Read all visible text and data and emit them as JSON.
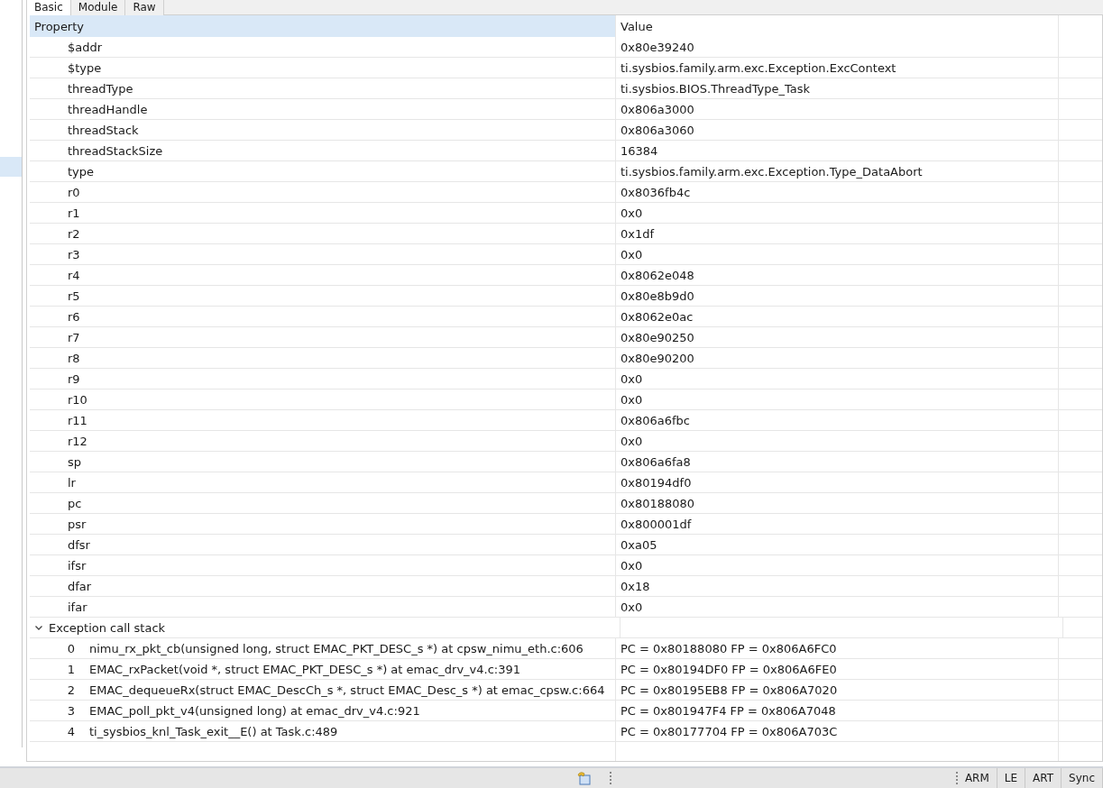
{
  "tabs": [
    {
      "label": "Basic",
      "selected": true
    },
    {
      "label": "Module",
      "selected": false
    },
    {
      "label": "Raw",
      "selected": false
    }
  ],
  "table": {
    "columns": [
      "Property",
      "Value"
    ],
    "rows": [
      {
        "name": "$addr",
        "value": "0x80e39240"
      },
      {
        "name": "$type",
        "value": "ti.sysbios.family.arm.exc.Exception.ExcContext"
      },
      {
        "name": "threadType",
        "value": "ti.sysbios.BIOS.ThreadType_Task"
      },
      {
        "name": "threadHandle",
        "value": "0x806a3000"
      },
      {
        "name": "threadStack",
        "value": "0x806a3060"
      },
      {
        "name": "threadStackSize",
        "value": "16384"
      },
      {
        "name": "type",
        "value": "ti.sysbios.family.arm.exc.Exception.Type_DataAbort"
      },
      {
        "name": "r0",
        "value": "0x8036fb4c"
      },
      {
        "name": "r1",
        "value": "0x0"
      },
      {
        "name": "r2",
        "value": "0x1df"
      },
      {
        "name": "r3",
        "value": "0x0"
      },
      {
        "name": "r4",
        "value": "0x8062e048"
      },
      {
        "name": "r5",
        "value": "0x80e8b9d0"
      },
      {
        "name": "r6",
        "value": "0x8062e0ac"
      },
      {
        "name": "r7",
        "value": "0x80e90250"
      },
      {
        "name": "r8",
        "value": "0x80e90200"
      },
      {
        "name": "r9",
        "value": "0x0"
      },
      {
        "name": "r10",
        "value": "0x0"
      },
      {
        "name": "r11",
        "value": "0x806a6fbc"
      },
      {
        "name": "r12",
        "value": "0x0"
      },
      {
        "name": "sp",
        "value": "0x806a6fa8"
      },
      {
        "name": "lr",
        "value": "0x80194df0"
      },
      {
        "name": "pc",
        "value": "0x80188080"
      },
      {
        "name": "psr",
        "value": "0x800001df"
      },
      {
        "name": "dfsr",
        "value": "0xa05"
      },
      {
        "name": "ifsr",
        "value": "0x0"
      },
      {
        "name": "dfar",
        "value": "0x18"
      },
      {
        "name": "ifar",
        "value": "0x0"
      }
    ],
    "group": {
      "label": "Exception call stack",
      "expanded": true,
      "children": [
        {
          "index": "0",
          "frame": "nimu_rx_pkt_cb(unsigned long, struct EMAC_PKT_DESC_s *) at cpsw_nimu_eth.c:606",
          "value": "PC = 0x80188080 FP = 0x806A6FC0"
        },
        {
          "index": "1",
          "frame": "EMAC_rxPacket(void *, struct EMAC_PKT_DESC_s *) at emac_drv_v4.c:391",
          "value": "PC = 0x80194DF0 FP = 0x806A6FE0"
        },
        {
          "index": "2",
          "frame": "EMAC_dequeueRx(struct EMAC_DescCh_s *, struct EMAC_Desc_s *) at emac_cpsw.c:664",
          "value": "PC = 0x80195EB8 FP = 0x806A7020"
        },
        {
          "index": "3",
          "frame": "EMAC_poll_pkt_v4(unsigned long) at emac_drv_v4.c:921",
          "value": "PC = 0x801947F4 FP = 0x806A7048"
        },
        {
          "index": "4",
          "frame": "ti_sysbios_knl_Task_exit__E() at Task.c:489",
          "value": "PC = 0x80177704 FP = 0x806A703C"
        }
      ]
    }
  },
  "status_bar": [
    "ARM",
    "LE",
    "ART",
    "Sync"
  ]
}
